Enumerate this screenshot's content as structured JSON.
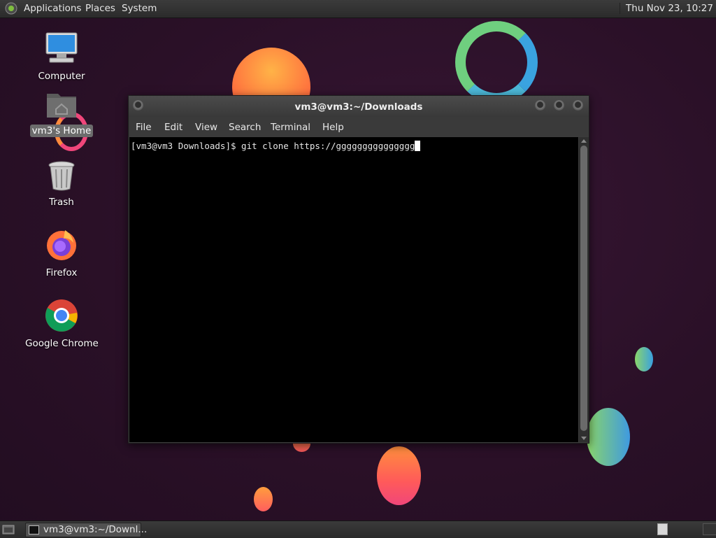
{
  "top_panel": {
    "menus": [
      "Applications",
      "Places",
      "System"
    ],
    "clock": "Thu Nov 23, 10:27"
  },
  "desktop": {
    "icons": [
      {
        "label": "Computer",
        "icon": "computer-icon"
      },
      {
        "label": "vm3's Home",
        "icon": "home-folder-icon",
        "selected": true
      },
      {
        "label": "Trash",
        "icon": "trash-icon"
      },
      {
        "label": "Firefox",
        "icon": "firefox-icon"
      },
      {
        "label": "Google Chrome",
        "icon": "chrome-icon"
      }
    ]
  },
  "terminal": {
    "title": "vm3@vm3:~/Downloads",
    "menu": [
      "File",
      "Edit",
      "View",
      "Search",
      "Terminal",
      "Help"
    ],
    "prompt_line": "[vm3@vm3 Downloads]$ git clone https://ggggggggggggggg"
  },
  "taskbar": {
    "window_button": "vm3@vm3:~/Downl..."
  },
  "colors": {
    "wallpaper": "#2a1128",
    "panel": "#333333",
    "terminal_bg": "#000000"
  }
}
